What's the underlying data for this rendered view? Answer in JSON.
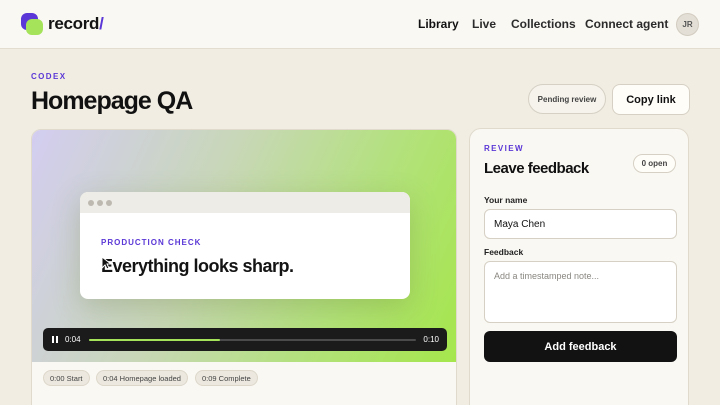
{
  "app": {
    "logo_text": "record",
    "logo_slash": "/"
  },
  "nav": {
    "library": "Library",
    "live": "Live",
    "collections": "Collections",
    "connect_agent": "Connect agent"
  },
  "user": {
    "initials": "JR"
  },
  "header": {
    "eyebrow": "CODEX",
    "title": "Homepage QA",
    "status_pill": "Pending review",
    "copy_link": "Copy link"
  },
  "player": {
    "browser_eyebrow": "PRODUCTION CHECK",
    "browser_headline": "Everything looks sharp.",
    "time_current": "0:04",
    "time_total": "0:10",
    "progress": 0.4,
    "chips": [
      "0:00 Start",
      "0:04 Homepage loaded",
      "0:09 Complete"
    ]
  },
  "review": {
    "eyebrow": "REVIEW",
    "title": "Leave feedback",
    "open_badge": "0 open",
    "name_label": "Your name",
    "name_value": "Maya Chen",
    "feedback_label": "Feedback",
    "feedback_placeholder": "Add a timestamped note...",
    "submit_label": "Add feedback"
  },
  "colors": {
    "accent": "#5a37d6",
    "lime": "#a4e35a",
    "background": "#f1ede3"
  }
}
